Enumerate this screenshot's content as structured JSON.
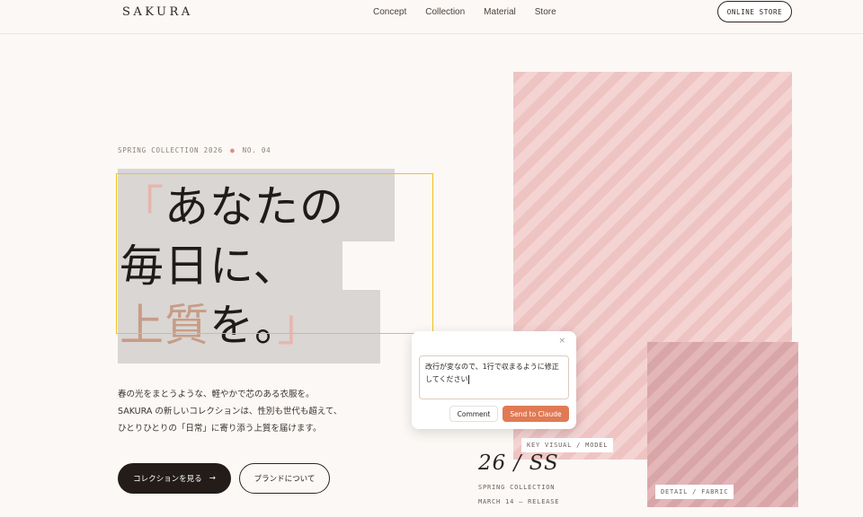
{
  "header": {
    "logo": "SAKURA",
    "menu": [
      "Concept",
      "Collection",
      "Material",
      "Store"
    ],
    "store_button": "ONLINE STORE"
  },
  "hero": {
    "eyebrow_collection": "SPRING COLLECTION 2026",
    "eyebrow_separator": "●",
    "eyebrow_number": "NO. 04",
    "headline": {
      "open_quote": "「",
      "line1": "あなたの",
      "line2": "毎日に、",
      "line3_accent": "上質",
      "line3_rest": "を。",
      "close_quote": "」"
    },
    "body_lines": [
      "春の光をまとうような、軽やかで芯のある衣服を。",
      "SAKURA の新しいコレクションは、性別も世代も超えて、",
      "ひとりひとりの「日常」に寄り添う上質を届けます。"
    ],
    "primary_button": "コレクションを見る",
    "primary_button_arrow": "→",
    "secondary_button": "ブランドについて"
  },
  "visual": {
    "main_tag": "KEY VISUAL / MODEL",
    "sub_tag": "DETAIL / FABRIC",
    "season": "26 / SS",
    "season_sub": "SPRING COLLECTION",
    "release": "MARCH 14 — RELEASE"
  },
  "comment_popup": {
    "close_glyph": "×",
    "text": "改行が変なので、1行で収まるように修正してください",
    "comment_button": "Comment",
    "send_button": "Send to Claude"
  },
  "colors": {
    "accent_pink": "#eec4c3",
    "selection_outline": "#f0c21b",
    "send_button": "#e07a54",
    "headline_accent": "#c79c86"
  }
}
